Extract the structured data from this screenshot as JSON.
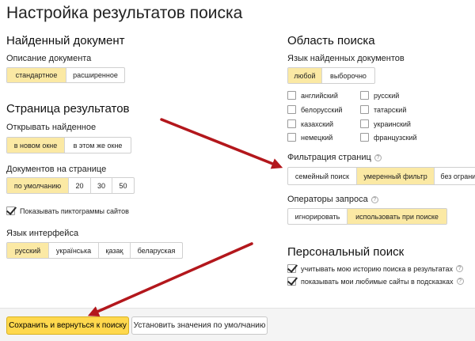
{
  "page_title": "Настройка результатов поиска",
  "found_doc": {
    "heading": "Найденный документ",
    "description_label": "Описание документа",
    "options": [
      "стандартное",
      "расширенное"
    ],
    "selected": 0
  },
  "results_page": {
    "heading": "Страница результатов",
    "open_label": "Открывать найденное",
    "open_options": [
      "в новом окне",
      "в этом же окне"
    ],
    "open_selected": 0,
    "docs_label": "Документов на странице",
    "docs_options": [
      "по умолчанию",
      "20",
      "30",
      "50"
    ],
    "docs_selected": 0,
    "show_icons_label": "Показывать пиктограммы сайтов",
    "show_icons_checked": true,
    "lang_label": "Язык интерфейса",
    "lang_options": [
      "русский",
      "українська",
      "қазақ",
      "беларуская"
    ],
    "lang_selected": 0
  },
  "search_area": {
    "heading": "Область поиска",
    "doc_lang_label": "Язык найденных документов",
    "doc_lang_options": [
      "любой",
      "выборочно"
    ],
    "doc_lang_selected": 0,
    "languages": [
      {
        "label": "английский",
        "checked": false
      },
      {
        "label": "русский",
        "checked": false
      },
      {
        "label": "белорусский",
        "checked": false
      },
      {
        "label": "татарский",
        "checked": false
      },
      {
        "label": "казахский",
        "checked": false
      },
      {
        "label": "украинский",
        "checked": false
      },
      {
        "label": "немецкий",
        "checked": false
      },
      {
        "label": "французский",
        "checked": false
      }
    ],
    "filter_label": "Фильтрация страниц",
    "filter_options": [
      "семейный поиск",
      "умеренный фильтр",
      "без ограничений"
    ],
    "filter_selected": 1,
    "operators_label": "Операторы запроса",
    "operators_options": [
      "игнорировать",
      "использовать при поиске"
    ],
    "operators_selected": 1
  },
  "personal": {
    "heading": "Персональный поиск",
    "history_label": "учитывать мою историю поиска в результатах",
    "history_checked": true,
    "favorites_label": "показывать мои любимые сайты в подсказках",
    "favorites_checked": true
  },
  "footer": {
    "save_label": "Сохранить и вернуться к поиску",
    "defaults_label": "Установить значения по умолчанию"
  },
  "help_glyph": "?",
  "colors": {
    "selected_bg": "#fbe9a4",
    "primary_button": "#ffd84d",
    "arrow": "#b3171c"
  }
}
